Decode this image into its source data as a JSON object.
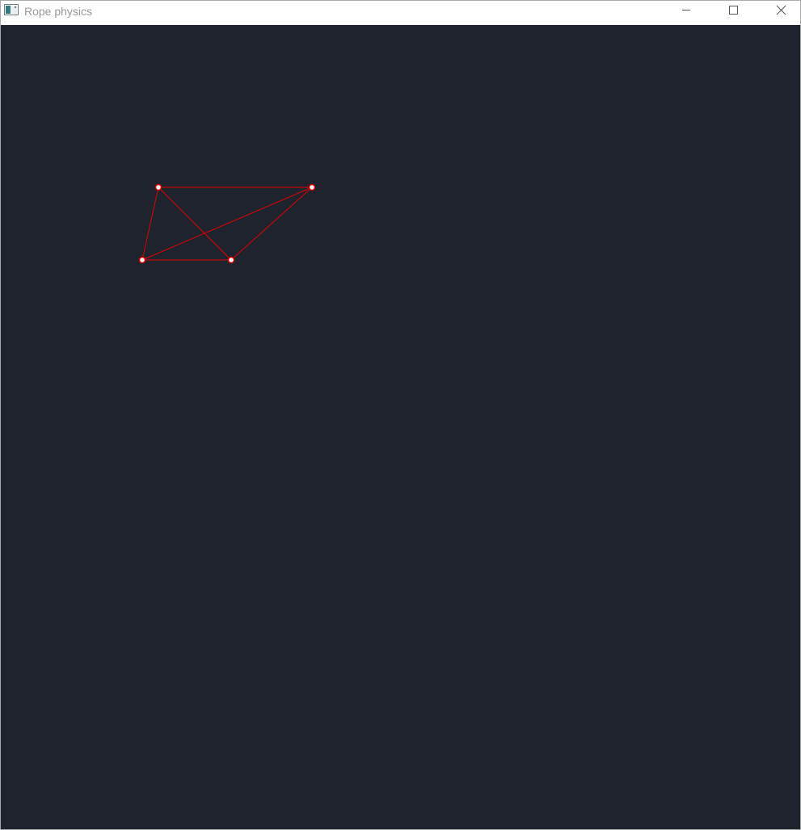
{
  "window": {
    "title": "Rope physics",
    "icon": "window-app-icon",
    "controls": {
      "minimize_icon": "minimize-icon",
      "maximize_icon": "maximize-icon",
      "close_icon": "close-icon"
    }
  },
  "colors": {
    "titlebar_bg": "#ffffff",
    "title_text": "#999999",
    "canvas_bg": "#1f232e",
    "stick": "#e00000",
    "point_fill": "#ffffff",
    "point_stroke": "#e00000"
  }
}
